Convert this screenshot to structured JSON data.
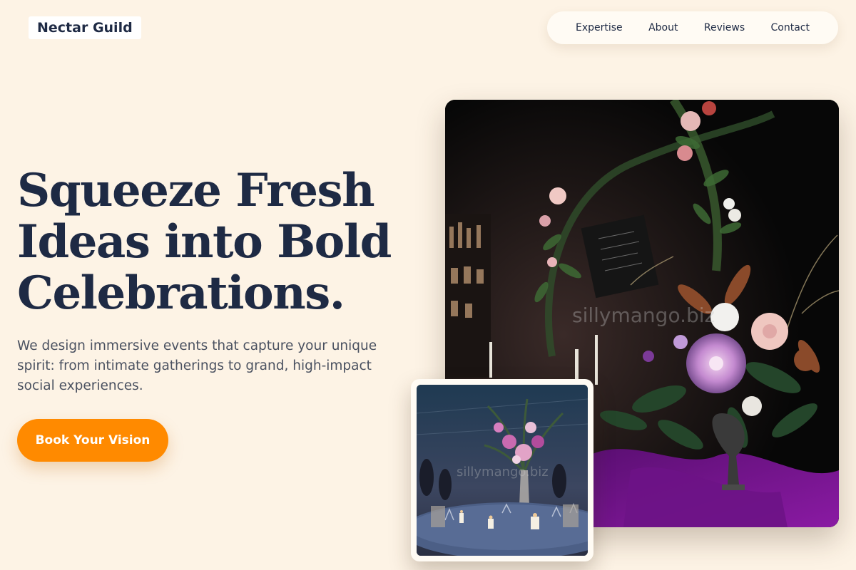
{
  "brand": {
    "name": "Nectar Guild"
  },
  "nav": {
    "items": [
      {
        "label": "Expertise"
      },
      {
        "label": "About"
      },
      {
        "label": "Reviews"
      },
      {
        "label": "Contact"
      }
    ]
  },
  "hero": {
    "headline_line1": "Squeeze Fresh",
    "headline_line2": "Ideas into Bold",
    "headline_line3": "Celebrations.",
    "description": "We design immersive events that capture your unique spirit: from intimate gatherings to grand, high-impact social experiences.",
    "cta_label": "Book Your Vision"
  },
  "images": {
    "main_watermark": "sillymango.biz",
    "inset_watermark": "sillymango.biz"
  },
  "colors": {
    "background": "#fdf3e5",
    "accent": "#ff8a00",
    "text_dark": "#1e2a44",
    "text_muted": "#4a5160"
  }
}
